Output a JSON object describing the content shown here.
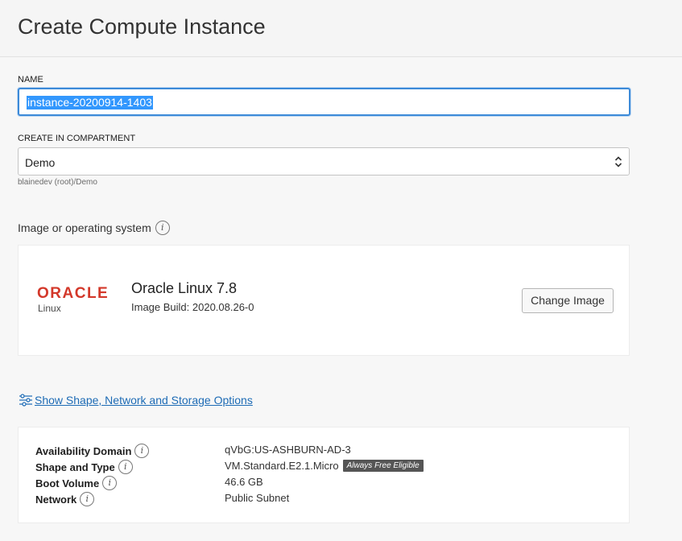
{
  "page": {
    "title": "Create Compute Instance"
  },
  "name_field": {
    "label": "NAME",
    "value": "instance-20200914-1403"
  },
  "compartment": {
    "label": "CREATE IN COMPARTMENT",
    "value": "Demo",
    "hint": "blainedev (root)/Demo"
  },
  "image_section": {
    "label": "Image or operating system",
    "logo_brand": "ORACLE",
    "logo_sub": "Linux",
    "os_name": "Oracle Linux 7.8",
    "build": "Image Build: 2020.08.26-0",
    "change_button": "Change Image"
  },
  "options_link": {
    "label": "Show Shape, Network and Storage Options"
  },
  "details": [
    {
      "label": "Availability Domain",
      "value": "qVbG:US-ASHBURN-AD-3",
      "badge": ""
    },
    {
      "label": "Shape and Type",
      "value": "VM.Standard.E2.1.Micro",
      "badge": "Always Free Eligible"
    },
    {
      "label": "Boot Volume",
      "value": "46.6 GB",
      "badge": ""
    },
    {
      "label": "Network",
      "value": "Public Subnet",
      "badge": ""
    }
  ],
  "colors": {
    "accent": "#1d6bb5",
    "oracle_red": "#d3382a",
    "focus": "#3c8ad8"
  }
}
